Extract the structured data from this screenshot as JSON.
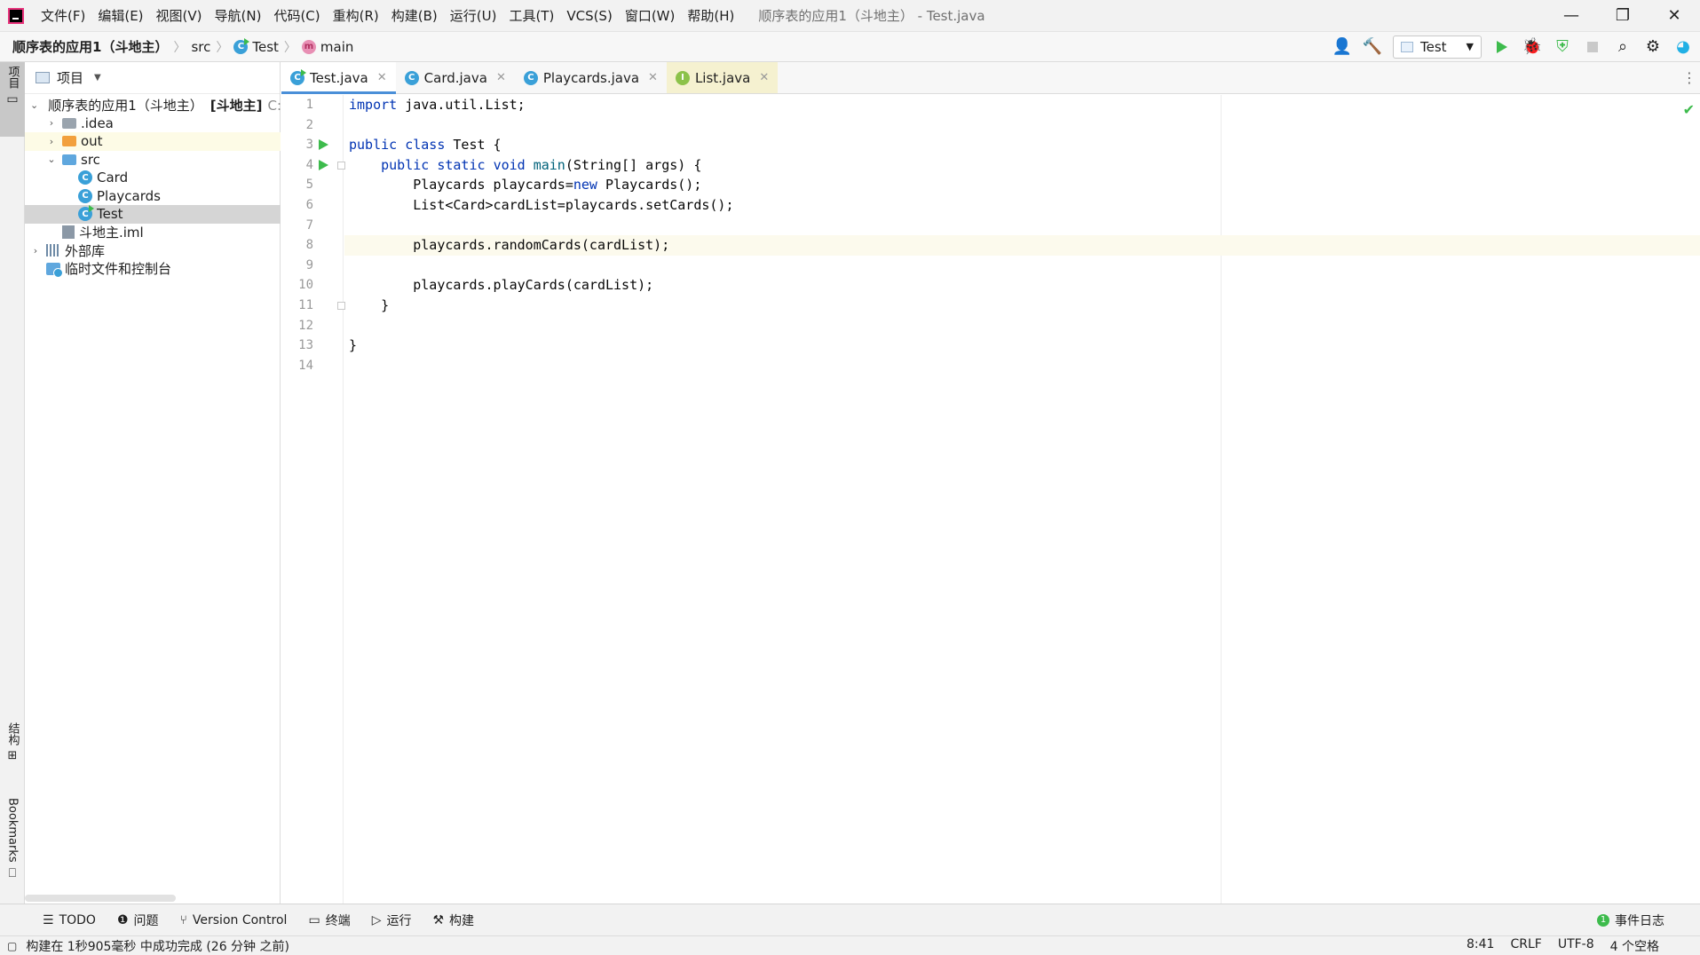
{
  "titlebar": {
    "menu": [
      "文件(F)",
      "编辑(E)",
      "视图(V)",
      "导航(N)",
      "代码(C)",
      "重构(R)",
      "构建(B)",
      "运行(U)",
      "工具(T)",
      "VCS(S)",
      "窗口(W)",
      "帮助(H)"
    ],
    "window_title": "顺序表的应用1（斗地主） - Test.java",
    "controls": {
      "minimize": "—",
      "restore": "❐",
      "close": "✕"
    }
  },
  "navbar": {
    "project": "顺序表的应用1（斗地主）",
    "path": [
      "src",
      "Test",
      "main"
    ],
    "run_config": "Test"
  },
  "left_strip": {
    "project_tab": "项目",
    "structure_tab": "结构",
    "bookmarks_tab": "Bookmarks"
  },
  "project_panel": {
    "title": "项目",
    "tree": [
      {
        "label": "顺序表的应用1（斗地主）",
        "module": "[斗地主]",
        "path": "C:\\代码\\",
        "depth": 0,
        "arrow": "⌄",
        "icon": "folder-gray"
      },
      {
        "label": ".idea",
        "depth": 1,
        "arrow": "›",
        "icon": "folder-gray"
      },
      {
        "label": "out",
        "depth": 1,
        "arrow": "›",
        "icon": "folder-orange"
      },
      {
        "label": "src",
        "depth": 1,
        "arrow": "⌄",
        "icon": "folder-blue"
      },
      {
        "label": "Card",
        "depth": 2,
        "icon": "class"
      },
      {
        "label": "Playcards",
        "depth": 2,
        "icon": "class"
      },
      {
        "label": "Test",
        "depth": 2,
        "icon": "class-run"
      },
      {
        "label": "斗地主.iml",
        "depth": 1,
        "icon": "iml"
      },
      {
        "label": "外部库",
        "depth": 0,
        "arrow": "›",
        "icon": "library"
      },
      {
        "label": "临时文件和控制台",
        "depth": 0,
        "icon": "scratch"
      }
    ]
  },
  "tabs": [
    {
      "label": "Test.java",
      "icon": "C",
      "active": true
    },
    {
      "label": "Card.java",
      "icon": "C",
      "active": false
    },
    {
      "label": "Playcards.java",
      "icon": "C",
      "active": false
    },
    {
      "label": "List.java",
      "icon": "I",
      "active": false
    }
  ],
  "code": [
    {
      "n": "1",
      "text": "import java.util.List;"
    },
    {
      "n": "2",
      "text": ""
    },
    {
      "n": "3",
      "text": "public class Test {"
    },
    {
      "n": "4",
      "text": "    public static void main(String[] args) {"
    },
    {
      "n": "5",
      "text": "        Playcards playcards=new Playcards();"
    },
    {
      "n": "6",
      "text": "        List<Card>cardList=playcards.setCards();"
    },
    {
      "n": "7",
      "text": ""
    },
    {
      "n": "8",
      "text": "        playcards.randomCards(cardList);"
    },
    {
      "n": "9",
      "text": ""
    },
    {
      "n": "10",
      "text": "        playcards.playCards(cardList);"
    },
    {
      "n": "11",
      "text": "    }"
    },
    {
      "n": "12",
      "text": ""
    },
    {
      "n": "13",
      "text": "}"
    },
    {
      "n": "14",
      "text": ""
    }
  ],
  "tool_strip": {
    "todo": "TODO",
    "problems": "问题",
    "vcs": "Version Control",
    "terminal": "终端",
    "run": "运行",
    "build": "构建",
    "event_log": "事件日志",
    "event_count": "1"
  },
  "statusbar": {
    "message": "构建在 1秒905毫秒 中成功完成 (26 分钟 之前)",
    "position": "8:41",
    "line_sep": "CRLF",
    "encoding": "UTF-8",
    "indent": "4 个空格"
  },
  "colors": {
    "accent": "#4a8fd8",
    "run_green": "#3dbb4c",
    "keyword": "#0033b3",
    "method": "#00627a"
  }
}
